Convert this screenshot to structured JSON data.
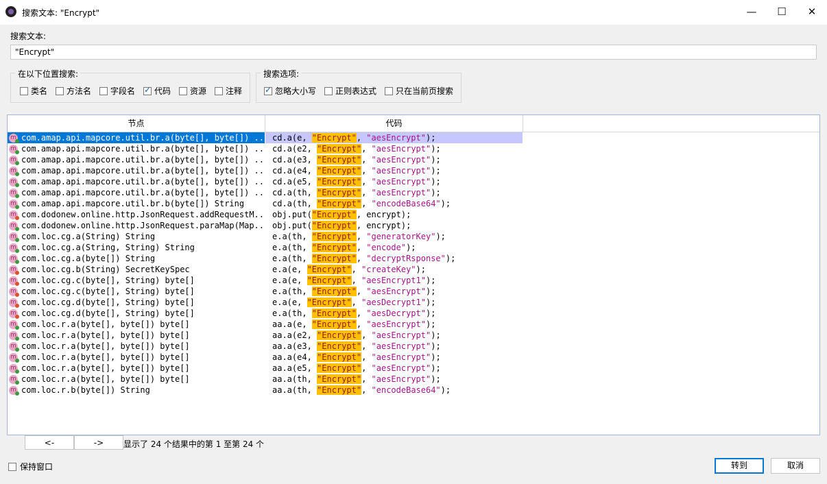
{
  "window": {
    "title": "搜索文本: \"Encrypt\"",
    "controls": {
      "minimize": "—",
      "maximize": "☐",
      "close": "✕"
    }
  },
  "search": {
    "label": "搜索文本:",
    "value": "\"Encrypt\""
  },
  "search_in": {
    "title": "在以下位置搜索:",
    "options": [
      {
        "label": "类名",
        "checked": false
      },
      {
        "label": "方法名",
        "checked": false
      },
      {
        "label": "字段名",
        "checked": false
      },
      {
        "label": "代码",
        "checked": true
      },
      {
        "label": "资源",
        "checked": false
      },
      {
        "label": "注释",
        "checked": false
      }
    ]
  },
  "search_options": {
    "title": "搜索选项:",
    "options": [
      {
        "label": "忽略大小写",
        "checked": true
      },
      {
        "label": "正则表达式",
        "checked": false
      },
      {
        "label": "只在当前页搜索",
        "checked": false
      }
    ]
  },
  "table": {
    "headers": {
      "node": "节点",
      "code": "代码"
    },
    "highlight": "\"Encrypt\"",
    "rows": [
      {
        "node": "com.amap.api.mapcore.util.br.a(byte[], byte[]) ...",
        "pre": "cd.a(e, ",
        "post": ", ",
        "str": "\"aesEncrypt\"",
        "end": ");",
        "icon": "public",
        "selected": true
      },
      {
        "node": "com.amap.api.mapcore.util.br.a(byte[], byte[]) ...",
        "pre": "cd.a(e2, ",
        "post": ", ",
        "str": "\"aesEncrypt\"",
        "end": ");",
        "icon": "public"
      },
      {
        "node": "com.amap.api.mapcore.util.br.a(byte[], byte[]) ...",
        "pre": "cd.a(e3, ",
        "post": ", ",
        "str": "\"aesEncrypt\"",
        "end": ");",
        "icon": "public"
      },
      {
        "node": "com.amap.api.mapcore.util.br.a(byte[], byte[]) ...",
        "pre": "cd.a(e4, ",
        "post": ", ",
        "str": "\"aesEncrypt\"",
        "end": ");",
        "icon": "public"
      },
      {
        "node": "com.amap.api.mapcore.util.br.a(byte[], byte[]) ...",
        "pre": "cd.a(e5, ",
        "post": ", ",
        "str": "\"aesEncrypt\"",
        "end": ");",
        "icon": "public"
      },
      {
        "node": "com.amap.api.mapcore.util.br.a(byte[], byte[]) ...",
        "pre": "cd.a(th, ",
        "post": ", ",
        "str": "\"aesEncrypt\"",
        "end": ");",
        "icon": "public"
      },
      {
        "node": "com.amap.api.mapcore.util.br.b(byte[]) String",
        "pre": "cd.a(th, ",
        "post": ", ",
        "str": "\"encodeBase64\"",
        "end": ");",
        "icon": "public"
      },
      {
        "node": "com.dodonew.online.http.JsonRequest.addRequestM...",
        "pre": "obj.put(",
        "post": ", encrypt);",
        "str": "",
        "end": "",
        "icon": "private"
      },
      {
        "node": "com.dodonew.online.http.JsonRequest.paraMap(Map...",
        "pre": "obj.put(",
        "post": ", encrypt);",
        "str": "",
        "end": "",
        "icon": "public"
      },
      {
        "node": "com.loc.cg.a(String) String",
        "pre": "e.a(th, ",
        "post": ", ",
        "str": "\"generatorKey\"",
        "end": ");",
        "icon": "public"
      },
      {
        "node": "com.loc.cg.a(String, String) String",
        "pre": "e.a(th, ",
        "post": ", ",
        "str": "\"encode\"",
        "end": ");",
        "icon": "public"
      },
      {
        "node": "com.loc.cg.a(byte[]) String",
        "pre": "e.a(th, ",
        "post": ", ",
        "str": "\"decryptRsponse\"",
        "end": ");",
        "icon": "public"
      },
      {
        "node": "com.loc.cg.b(String) SecretKeySpec",
        "pre": "e.a(e, ",
        "post": ", ",
        "str": "\"createKey\"",
        "end": ");",
        "icon": "private"
      },
      {
        "node": "com.loc.cg.c(byte[], String) byte[]",
        "pre": "e.a(e, ",
        "post": ", ",
        "str": "\"aesEncrypt1\"",
        "end": ");",
        "icon": "private"
      },
      {
        "node": "com.loc.cg.c(byte[], String) byte[]",
        "pre": "e.a(th, ",
        "post": ", ",
        "str": "\"aesEncrypt\"",
        "end": ");",
        "icon": "private"
      },
      {
        "node": "com.loc.cg.d(byte[], String) byte[]",
        "pre": "e.a(e, ",
        "post": ", ",
        "str": "\"aesDecrypt1\"",
        "end": ");",
        "icon": "private"
      },
      {
        "node": "com.loc.cg.d(byte[], String) byte[]",
        "pre": "e.a(th, ",
        "post": ", ",
        "str": "\"aesDecrypt\"",
        "end": ");",
        "icon": "private"
      },
      {
        "node": "com.loc.r.a(byte[], byte[]) byte[]",
        "pre": "aa.a(e, ",
        "post": ", ",
        "str": "\"aesEncrypt\"",
        "end": ");",
        "icon": "public"
      },
      {
        "node": "com.loc.r.a(byte[], byte[]) byte[]",
        "pre": "aa.a(e2, ",
        "post": ", ",
        "str": "\"aesEncrypt\"",
        "end": ");",
        "icon": "public"
      },
      {
        "node": "com.loc.r.a(byte[], byte[]) byte[]",
        "pre": "aa.a(e3, ",
        "post": ", ",
        "str": "\"aesEncrypt\"",
        "end": ");",
        "icon": "public"
      },
      {
        "node": "com.loc.r.a(byte[], byte[]) byte[]",
        "pre": "aa.a(e4, ",
        "post": ", ",
        "str": "\"aesEncrypt\"",
        "end": ");",
        "icon": "public"
      },
      {
        "node": "com.loc.r.a(byte[], byte[]) byte[]",
        "pre": "aa.a(e5, ",
        "post": ", ",
        "str": "\"aesEncrypt\"",
        "end": ");",
        "icon": "public"
      },
      {
        "node": "com.loc.r.a(byte[], byte[]) byte[]",
        "pre": "aa.a(th, ",
        "post": ", ",
        "str": "\"aesEncrypt\"",
        "end": ");",
        "icon": "public"
      },
      {
        "node": "com.loc.r.b(byte[]) String",
        "pre": "aa.a(th, ",
        "post": ", ",
        "str": "\"encodeBase64\"",
        "end": ");",
        "icon": "public"
      }
    ]
  },
  "pagination": {
    "prev_label": "<-",
    "next_label": "->",
    "info": "显示了 24 个结果中的第 1 至第 24 个"
  },
  "footer": {
    "keep_window": "保持窗口",
    "goto": "转到",
    "cancel": "取消"
  },
  "colors": {
    "highlight_bg": "#ffc000",
    "selection_bg": "#0078d7",
    "string_color": "#a3158a"
  }
}
